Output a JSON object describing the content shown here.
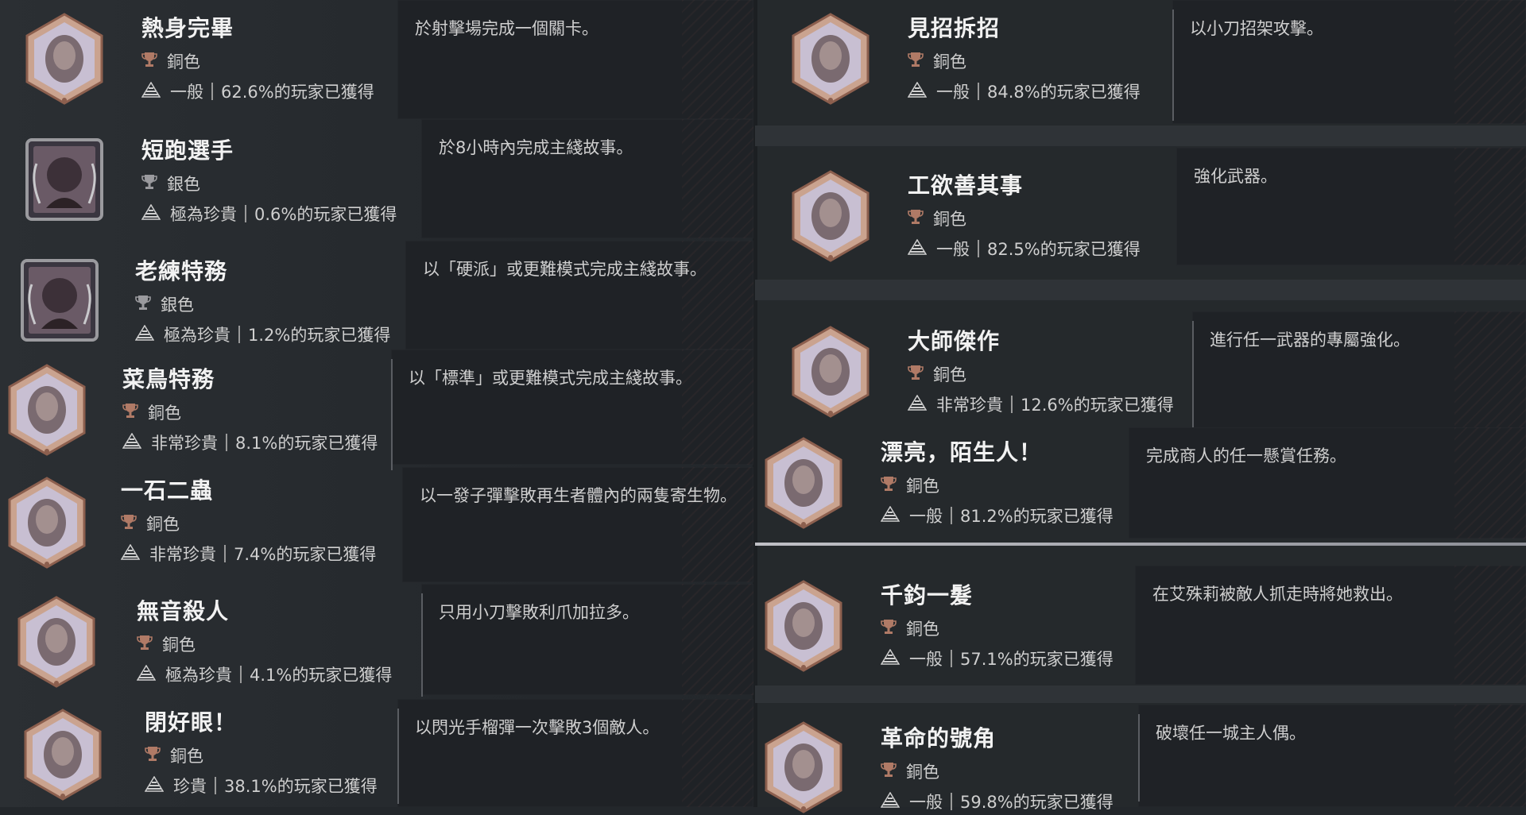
{
  "left": [
    {
      "title": "熱身完畢",
      "tier": "銅色",
      "rarity": "一般",
      "percent": "62.6%的玩家已獲得",
      "desc": "於射擊場完成一個關卡。",
      "icon": "target-plaque-icon",
      "frame": "hex"
    },
    {
      "title": "短跑選手",
      "tier": "銀色",
      "rarity": "極為珍貴",
      "percent": "0.6%的玩家已獲得",
      "desc": "於8小時內完成主綫故事。",
      "icon": "running-figure-icon",
      "frame": "square"
    },
    {
      "title": "老練特務",
      "tier": "銀色",
      "rarity": "極為珍貴",
      "percent": "1.2%的玩家已獲得",
      "desc": "以「硬派」或更難模式完成主綫故事。",
      "icon": "agent-portrait-icon",
      "frame": "square"
    },
    {
      "title": "菜鳥特務",
      "tier": "銅色",
      "rarity": "非常珍貴",
      "percent": "8.1%的玩家已獲得",
      "desc": "以「標準」或更難模式完成主綫故事。",
      "icon": "rookie-agent-icon",
      "frame": "hex"
    },
    {
      "title": "一石二蟲",
      "tier": "銅色",
      "rarity": "非常珍貴",
      "percent": "7.4%的玩家已獲得",
      "desc": "以一發子彈擊敗再生者體內的兩隻寄生物。",
      "icon": "regenerator-icon",
      "frame": "hex"
    },
    {
      "title": "無音殺人",
      "tier": "銅色",
      "rarity": "極為珍貴",
      "percent": "4.1%的玩家已獲得",
      "desc": "只用小刀擊敗利爪加拉多。",
      "icon": "masked-enemy-icon",
      "frame": "hex"
    },
    {
      "title": "閉好眼！",
      "tier": "銅色",
      "rarity": "珍貴",
      "percent": "38.1%的玩家已獲得",
      "desc": "以閃光手榴彈一次擊敗3個敵人。",
      "icon": "flash-grenade-icon",
      "frame": "hex"
    }
  ],
  "right": [
    {
      "title": "見招拆招",
      "tier": "銅色",
      "rarity": "一般",
      "percent": "84.8%的玩家已獲得",
      "desc": "以小刀招架攻擊。",
      "icon": "crossed-axe-icon",
      "frame": "hex"
    },
    {
      "title": "工欲善其事",
      "tier": "銅色",
      "rarity": "一般",
      "percent": "82.5%的玩家已獲得",
      "desc": "強化武器。",
      "icon": "pistol-tools-icon",
      "frame": "hex"
    },
    {
      "title": "大師傑作",
      "tier": "銅色",
      "rarity": "非常珍貴",
      "percent": "12.6%的玩家已獲得",
      "desc": "進行任一武器的專屬強化。",
      "icon": "ticket-icon",
      "frame": "hex"
    },
    {
      "title": "漂亮，陌生人！",
      "tier": "銅色",
      "rarity": "一般",
      "percent": "81.2%的玩家已獲得",
      "desc": "完成商人的任一懸賞任務。",
      "icon": "target-pole-icon",
      "frame": "hex"
    },
    {
      "title": "千鈞一髮",
      "tier": "銅色",
      "rarity": "一般",
      "percent": "57.1%的玩家已獲得",
      "desc": "在艾殊莉被敵人抓走時將她救出。",
      "icon": "ashley-icon",
      "frame": "hex"
    },
    {
      "title": "革命的號角",
      "tier": "銅色",
      "rarity": "一般",
      "percent": "59.8%的玩家已獲得",
      "desc": "破壞任一城主人偶。",
      "icon": "crossbow-doll-icon",
      "frame": "hex"
    }
  ],
  "colors": {
    "bronze": "#b07a66",
    "silver": "#9a9a9e",
    "hex_fill": "#c9bfd0",
    "hex_border": "#a77a68"
  }
}
